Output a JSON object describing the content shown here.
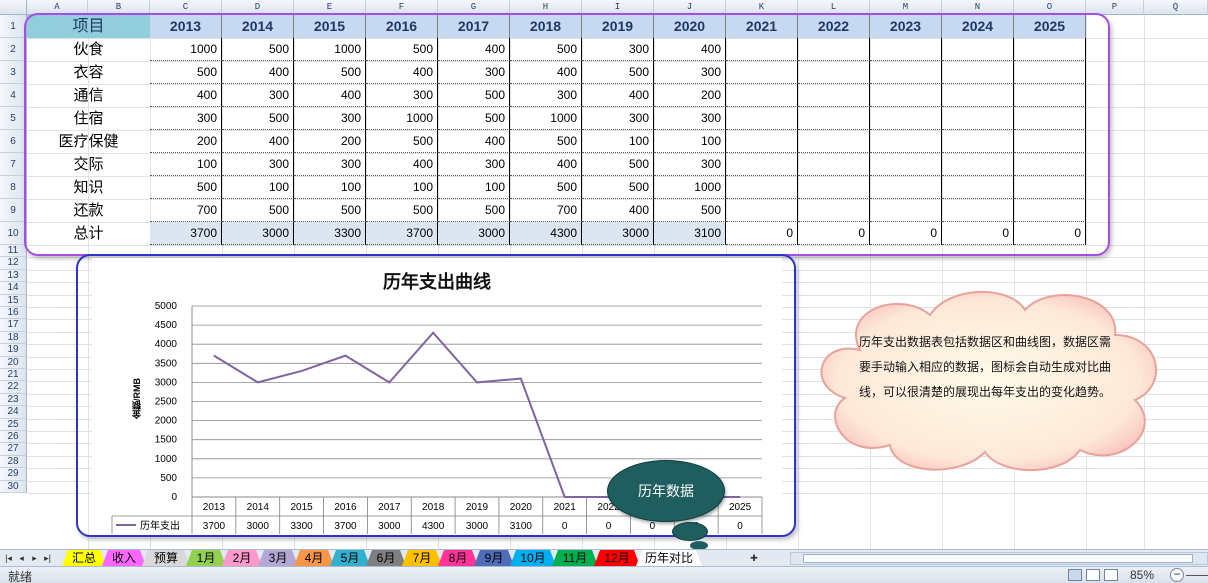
{
  "columns": [
    "A",
    "B",
    "C",
    "D",
    "E",
    "F",
    "G",
    "H",
    "I",
    "J",
    "K",
    "L",
    "M",
    "N",
    "O",
    "P",
    "Q"
  ],
  "rows": [
    "1",
    "2",
    "3",
    "4",
    "5",
    "6",
    "7",
    "8",
    "9",
    "10",
    "11",
    "12",
    "13",
    "14",
    "15",
    "16",
    "17",
    "18",
    "19",
    "20",
    "21",
    "22",
    "23",
    "24",
    "25",
    "26",
    "27",
    "28",
    "29",
    "30"
  ],
  "table": {
    "header_label": "项目",
    "years": [
      "2013",
      "2014",
      "2015",
      "2016",
      "2017",
      "2018",
      "2019",
      "2020",
      "2021",
      "2022",
      "2023",
      "2024",
      "2025"
    ],
    "rows": [
      {
        "label": "伙食",
        "values": [
          "1000",
          "500",
          "1000",
          "500",
          "400",
          "500",
          "300",
          "400",
          "",
          "",
          "",
          "",
          ""
        ]
      },
      {
        "label": "衣容",
        "values": [
          "500",
          "400",
          "500",
          "400",
          "300",
          "400",
          "500",
          "300",
          "",
          "",
          "",
          "",
          ""
        ]
      },
      {
        "label": "通信",
        "values": [
          "400",
          "300",
          "400",
          "300",
          "500",
          "300",
          "400",
          "200",
          "",
          "",
          "",
          "",
          ""
        ]
      },
      {
        "label": "住宿",
        "values": [
          "300",
          "500",
          "300",
          "1000",
          "500",
          "1000",
          "300",
          "300",
          "",
          "",
          "",
          "",
          ""
        ]
      },
      {
        "label": "医疗保健",
        "values": [
          "200",
          "400",
          "200",
          "500",
          "400",
          "500",
          "100",
          "100",
          "",
          "",
          "",
          "",
          ""
        ]
      },
      {
        "label": "交际",
        "values": [
          "100",
          "300",
          "300",
          "400",
          "300",
          "400",
          "500",
          "300",
          "",
          "",
          "",
          "",
          ""
        ]
      },
      {
        "label": "知识",
        "values": [
          "500",
          "100",
          "100",
          "100",
          "100",
          "500",
          "500",
          "1000",
          "",
          "",
          "",
          "",
          ""
        ]
      },
      {
        "label": "还款",
        "values": [
          "700",
          "500",
          "500",
          "500",
          "500",
          "700",
          "400",
          "500",
          "",
          "",
          "",
          "",
          ""
        ]
      }
    ],
    "total": {
      "label": "总计",
      "values": [
        "3700",
        "3000",
        "3300",
        "3700",
        "3000",
        "4300",
        "3000",
        "3100",
        "0",
        "0",
        "0",
        "0",
        "0"
      ]
    }
  },
  "chart_data": {
    "type": "line",
    "title": "历年支出曲线",
    "ylabel": "金额/RMB",
    "xlabel": "",
    "categories": [
      "2013",
      "2014",
      "2015",
      "2016",
      "2017",
      "2018",
      "2019",
      "2020",
      "2021",
      "2022",
      "2023",
      "2024",
      "2025"
    ],
    "series": [
      {
        "name": "历年支出",
        "values": [
          3700,
          3000,
          3300,
          3700,
          3000,
          4300,
          3000,
          3100,
          0,
          0,
          0,
          0,
          0
        ],
        "color": "#8064a2"
      }
    ],
    "yticks": [
      "0",
      "500",
      "1000",
      "1500",
      "2000",
      "2500",
      "3000",
      "3500",
      "4000",
      "4500",
      "5000"
    ],
    "ylim": [
      0,
      5000
    ],
    "grid": true,
    "legend": "bottom-left data table",
    "data_table_labels": [
      "3700",
      "3000",
      "3300",
      "3700",
      "3000",
      "4300",
      "3000",
      "3100",
      "0",
      "0",
      "0",
      "0",
      "0"
    ]
  },
  "callout": {
    "cloud_text": "历年支出数据表包括数据区和曲线图，数据区需要手动输入相应的数据，图标会自动生成对比曲线，可以很清楚的展现出每年支出的变化趋势。",
    "bubble_text": "历年数据"
  },
  "sheet_tabs": [
    {
      "label": "汇总",
      "color": "#ffff00",
      "active": false
    },
    {
      "label": "收入",
      "color": "#ff66ff",
      "active": false
    },
    {
      "label": "预算",
      "color": "#d9d9d9",
      "active": false
    },
    {
      "label": "1月",
      "color": "#92d050",
      "active": false
    },
    {
      "label": "2月",
      "color": "#ff99cc",
      "active": false
    },
    {
      "label": "3月",
      "color": "#b4a7d6",
      "active": false
    },
    {
      "label": "4月",
      "color": "#f79646",
      "active": false
    },
    {
      "label": "5月",
      "color": "#31b0d0",
      "active": false
    },
    {
      "label": "6月",
      "color": "#7f7f7f",
      "active": false
    },
    {
      "label": "7月",
      "color": "#ffc000",
      "active": false
    },
    {
      "label": "8月",
      "color": "#ff3399",
      "active": false
    },
    {
      "label": "9月",
      "color": "#4f6db8",
      "active": false
    },
    {
      "label": "10月",
      "color": "#00b0f0",
      "active": false
    },
    {
      "label": "11月",
      "color": "#00b050",
      "active": false
    },
    {
      "label": "12月",
      "color": "#ff0000",
      "active": false
    },
    {
      "label": "历年对比",
      "color": "#ffffff",
      "active": true
    }
  ],
  "status": {
    "ready": "就绪",
    "zoom": "85%"
  },
  "colors": {
    "accent_purple": "#a44ee5",
    "accent_blue": "#2f33c9",
    "bubble": "#1f5e5f",
    "line": "#8064a2"
  }
}
